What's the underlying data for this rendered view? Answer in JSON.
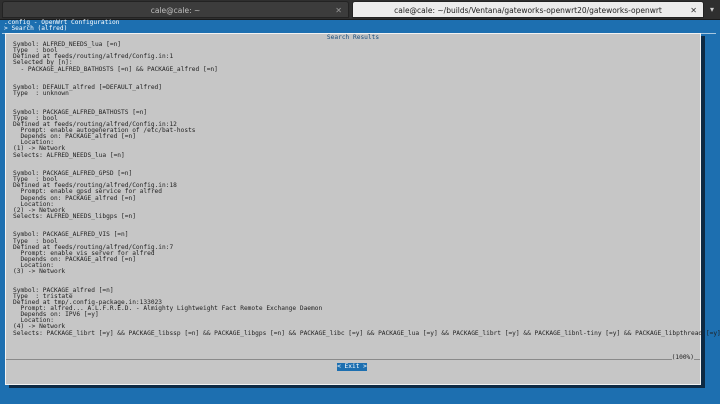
{
  "tabs": [
    {
      "title": "cale@cale: ~",
      "active": false
    },
    {
      "title": "cale@cale: ~/builds/Ventana/gateworks-openwrt20/gateworks-openwrt",
      "active": true
    }
  ],
  "tab_close_glyph": "✕",
  "tab_menu_glyph": "▾",
  "terminal": {
    "header_line1": ".config - OpenWrt Configuration",
    "header_line2": "> Search (alfred)"
  },
  "dialog": {
    "title": "Search Results",
    "lines": [
      "Symbol: ALFRED_NEEDS_lua [=n]",
      "Type  : bool",
      "Defined at feeds/routing/alfred/Config.in:1",
      "Selected by [n]:",
      "  - PACKAGE_ALFRED_BATHOSTS [=n] && PACKAGE_alfred [=n]",
      "",
      "",
      "Symbol: DEFAULT_alfred [=DEFAULT_alfred]",
      "Type  : unknown",
      "",
      "",
      "Symbol: PACKAGE_ALFRED_BATHOSTS [=n]",
      "Type  : bool",
      "Defined at feeds/routing/alfred/Config.in:12",
      "  Prompt: enable autogeneration of /etc/bat-hosts",
      "  Depends on: PACKAGE_alfred [=n]",
      "  Location:",
      "(1) -> Network",
      "Selects: ALFRED_NEEDS_lua [=n]",
      "",
      "",
      "Symbol: PACKAGE_ALFRED_GPSD [=n]",
      "Type  : bool",
      "Defined at feeds/routing/alfred/Config.in:18",
      "  Prompt: enable gpsd service for alfred",
      "  Depends on: PACKAGE_alfred [=n]",
      "  Location:",
      "(2) -> Network",
      "Selects: ALFRED_NEEDS_libgps [=n]",
      "",
      "",
      "Symbol: PACKAGE_ALFRED_VIS [=n]",
      "Type  : bool",
      "Defined at feeds/routing/alfred/Config.in:7",
      "  Prompt: enable vis server for alfred",
      "  Depends on: PACKAGE_alfred [=n]",
      "  Location:",
      "(3) -> Network",
      "",
      "",
      "Symbol: PACKAGE_alfred [=n]",
      "Type  : tristate",
      "Defined at tmp/.config-package.in:133023",
      "  Prompt: alfred... A.L.F.R.E.D. - Almighty Lightweight Fact Remote Exchange Daemon",
      "  Depends on: IPV6 [=y]",
      "  Location:",
      "(4) -> Network",
      "Selects: PACKAGE_librt [=y] && PACKAGE_libssp [=n] && PACKAGE_libgps [=n] && PACKAGE_libc [=y] && PACKAGE_lua [=y] && PACKAGE_librt [=y] && PACKAGE_libnl-tiny [=y] && PACKAGE_libpthread [=y]"
    ],
    "percent": "(100%)",
    "exit_label": "< Exit >"
  }
}
